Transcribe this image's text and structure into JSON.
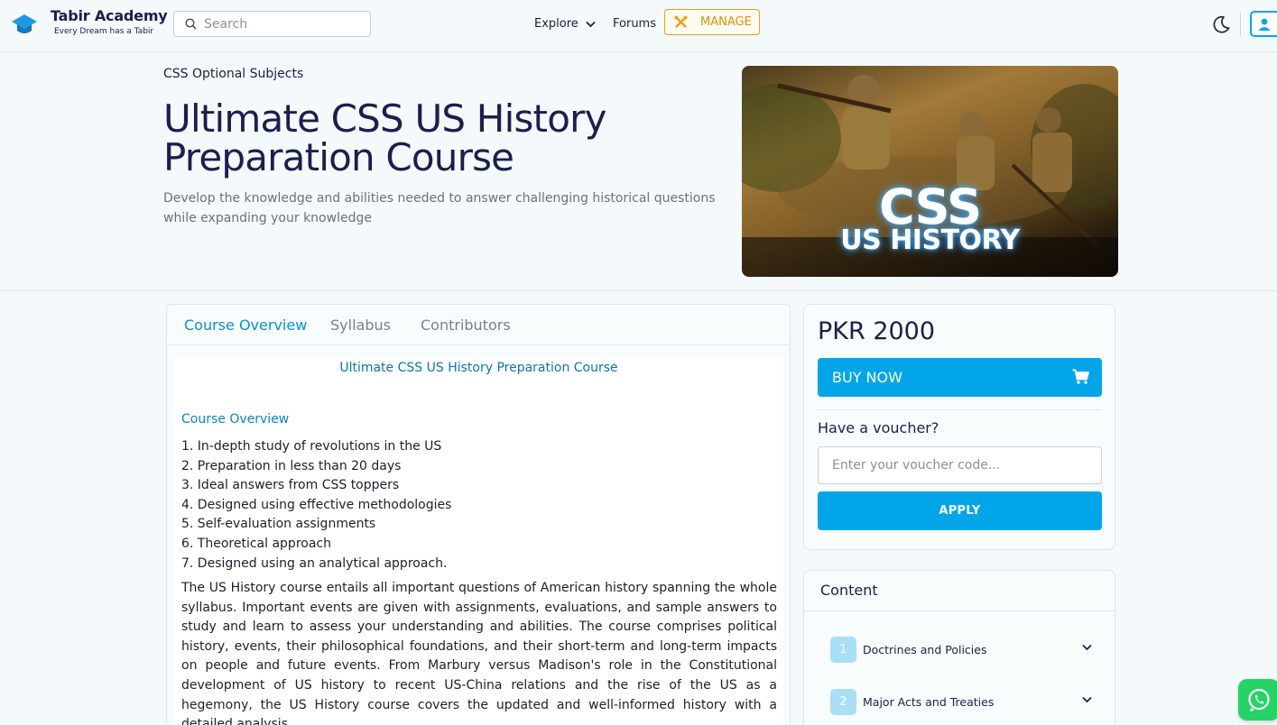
{
  "brand": {
    "name": "Tabir Academy",
    "tagline": "Every Dream has a Tabir",
    "logo_icon": "graduation-cap-icon",
    "color": "#1e9be0"
  },
  "search": {
    "placeholder": "Search",
    "icon": "search-icon"
  },
  "nav": {
    "explore": "Explore",
    "forums": "Forums",
    "manage": "MANAGE"
  },
  "colors": {
    "accent": "#02a6e8",
    "manage": "#e2a21c",
    "text": "#1a1f4d",
    "whatsapp": "#25d366"
  },
  "hero": {
    "breadcrumb": "CSS Optional Subjects",
    "title": "Ultimate CSS US History Preparation Course",
    "subtitle": "Develop the knowledge and abilities needed to answer challenging historical questions while expanding your knowledge",
    "image_text_1": "CSS",
    "image_text_2": "US HISTORY"
  },
  "tabs": [
    {
      "label": "Course Overview",
      "active": true
    },
    {
      "label": "Syllabus",
      "active": false
    },
    {
      "label": "Contributors",
      "active": false
    }
  ],
  "overview": {
    "heading": "Ultimate CSS US History Preparation Course",
    "subheading": "Course Overview",
    "items": [
      "1. In-depth study of revolutions in the US",
      "2. Preparation in less than 20 days",
      "3. Ideal answers from CSS toppers",
      "4. Designed using effective methodologies",
      "5. Self-evaluation assignments",
      "6. Theoretical approach",
      "7. Designed using an analytical approach."
    ],
    "paragraph": "The US History course entails all important questions of American history spanning the whole syllabus. Important events are given with assignments, evaluations, and sample answers to study and learn to assess your understanding and abilities. The course comprises political history, events, their philosophical foundations, and their short-term and long-term impacts on people and future events. From Marbury versus Madison's role in the Constitutional development of US history to recent US-China relations and the rise of the US as a hegemony, the US History course covers the updated and well-informed history with a detailed analysis."
  },
  "purchase": {
    "price": "PKR 2000",
    "buy_label": "BUY NOW",
    "voucher_label": "Have a voucher?",
    "voucher_placeholder": "Enter your voucher code...",
    "apply_label": "APPLY"
  },
  "content": {
    "title": "Content",
    "items": [
      {
        "number": "1",
        "label": "Doctrines and Policies"
      },
      {
        "number": "2",
        "label": "Major Acts and Treaties"
      }
    ]
  }
}
